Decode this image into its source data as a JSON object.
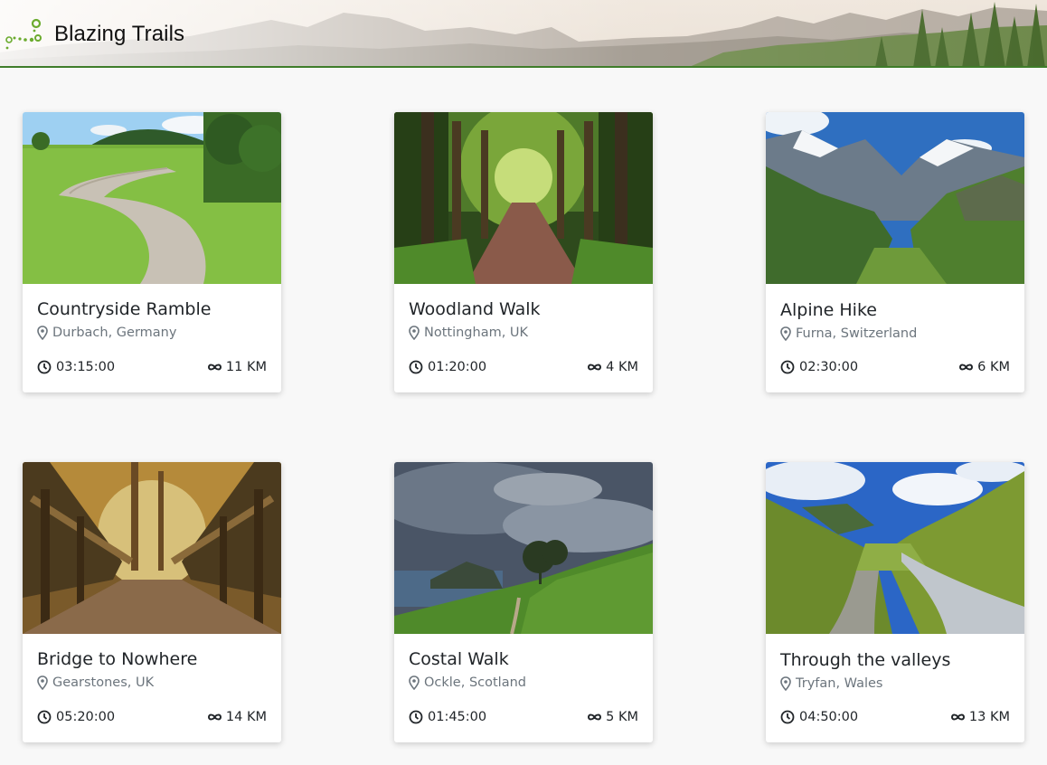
{
  "app": {
    "title": "Blazing Trails",
    "logo_icon": "trail-dots-logo-icon",
    "accent_color": "#3f7d2a"
  },
  "trails": [
    {
      "name": "Countryside Ramble",
      "location": "Durbach, Germany",
      "duration": "03:15:00",
      "distance": "11 KM",
      "image": "countryside-path-photo"
    },
    {
      "name": "Woodland Walk",
      "location": "Nottingham, UK",
      "duration": "01:20:00",
      "distance": "4 KM",
      "image": "woodland-path-photo"
    },
    {
      "name": "Alpine Hike",
      "location": "Furna, Switzerland",
      "duration": "02:30:00",
      "distance": "6 KM",
      "image": "alpine-valley-photo"
    },
    {
      "name": "Bridge to Nowhere",
      "location": "Gearstones, UK",
      "duration": "05:20:00",
      "distance": "14 KM",
      "image": "wooden-bridge-photo"
    },
    {
      "name": "Costal Walk",
      "location": "Ockle, Scotland",
      "duration": "01:45:00",
      "distance": "5 KM",
      "image": "coastal-cliff-photo"
    },
    {
      "name": "Through the valleys",
      "location": "Tryfan, Wales",
      "duration": "04:50:00",
      "distance": "13 KM",
      "image": "valley-stream-photo"
    }
  ],
  "icons": {
    "location": "map-pin-icon",
    "duration": "clock-icon",
    "distance": "infinity-icon"
  }
}
